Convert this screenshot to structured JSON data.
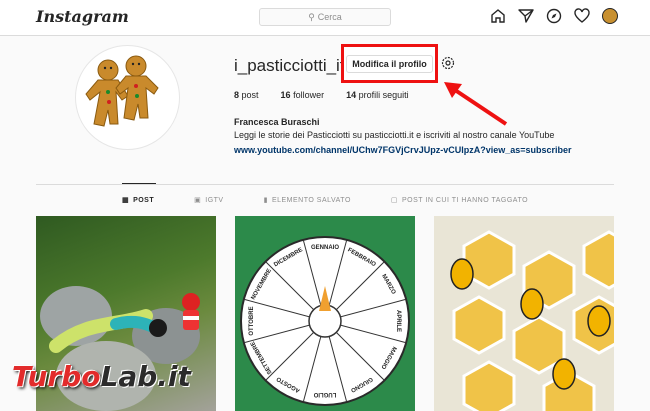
{
  "header": {
    "logo": "Instagram",
    "search_placeholder": "Cerca"
  },
  "profile": {
    "username": "i_pasticciotti_it",
    "edit_button": "Modifica il profilo",
    "stats": [
      {
        "count": "8",
        "label": "post"
      },
      {
        "count": "16",
        "label": "follower"
      },
      {
        "count": "14",
        "label": "profili seguiti"
      }
    ],
    "full_name": "Francesca Buraschi",
    "bio": "Leggi le storie dei Pasticciotti su pasticciotti.it e iscriviti al nostro canale YouTube",
    "link": "www.youtube.com/channel/UChw7FGVjCrvJUpz-vCUlpzA?view_as=subscriber"
  },
  "tabs": [
    {
      "label": "POST",
      "icon": "grid-icon"
    },
    {
      "label": "IGTV",
      "icon": "tv-icon"
    },
    {
      "label": "ELEMENTO SALVATO",
      "icon": "bookmark-icon"
    },
    {
      "label": "POST IN CUI TI HANNO TAGGATO",
      "icon": "tag-icon"
    }
  ],
  "wheel_words": [
    "GENNAIO",
    "FEBBRAIO",
    "MARZO",
    "APRILE",
    "MAGGIO",
    "GIUGNO",
    "LUGLIO",
    "AGOSTO",
    "SETTEMBRE",
    "OTTOBRE",
    "NOVEMBRE",
    "DICEMBRE"
  ],
  "watermark": {
    "part1": "Turbo",
    "part2": "Lab.it"
  },
  "colors": {
    "highlight": "#ee1111",
    "link": "#003569"
  }
}
